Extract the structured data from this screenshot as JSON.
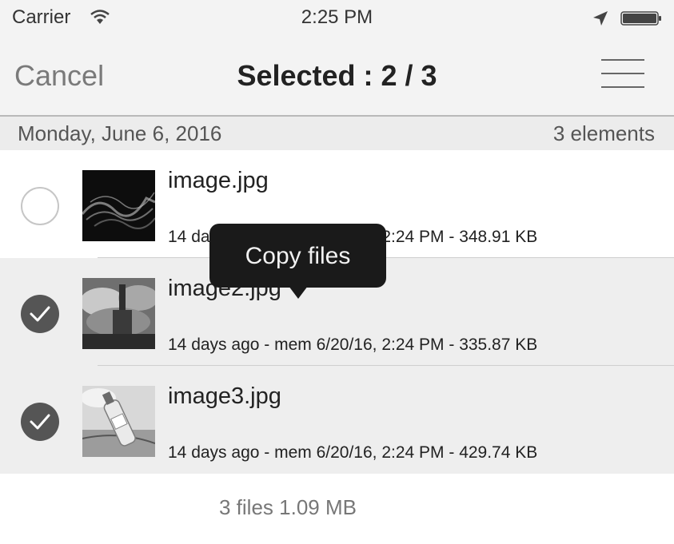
{
  "status_bar": {
    "carrier": "Carrier",
    "time": "2:25 PM",
    "icons": [
      "wifi-icon",
      "location-arrow-icon",
      "battery-icon"
    ]
  },
  "nav": {
    "cancel_label": "Cancel",
    "title": "Selected : 2 / 3",
    "menu_icon": "hamburger-menu-icon"
  },
  "section": {
    "date": "Monday, June 6, 2016",
    "count": "3 elements"
  },
  "files": [
    {
      "name": "image.jpg",
      "meta": "14 days ago - mem 6/20/16, 2:24 PM - 348.91 KB",
      "selected": false,
      "thumb": "dark-smoke-thumbnail"
    },
    {
      "name": "image2.jpg",
      "meta": "14 days ago - mem 6/20/16, 2:24 PM - 335.87 KB",
      "selected": true,
      "thumb": "cloudy-castle-thumbnail"
    },
    {
      "name": "image3.jpg",
      "meta": "14 days ago - mem 6/20/16, 2:24 PM - 429.74 KB",
      "selected": true,
      "thumb": "bottle-thumbnail"
    }
  ],
  "tooltip": {
    "label": "Copy files"
  },
  "footer": {
    "summary": "3 files 1.09 MB"
  },
  "colors": {
    "checkmark_bg": "#555555",
    "selected_row_bg": "#eeeeee",
    "tooltip_bg": "#1a1a1a"
  }
}
